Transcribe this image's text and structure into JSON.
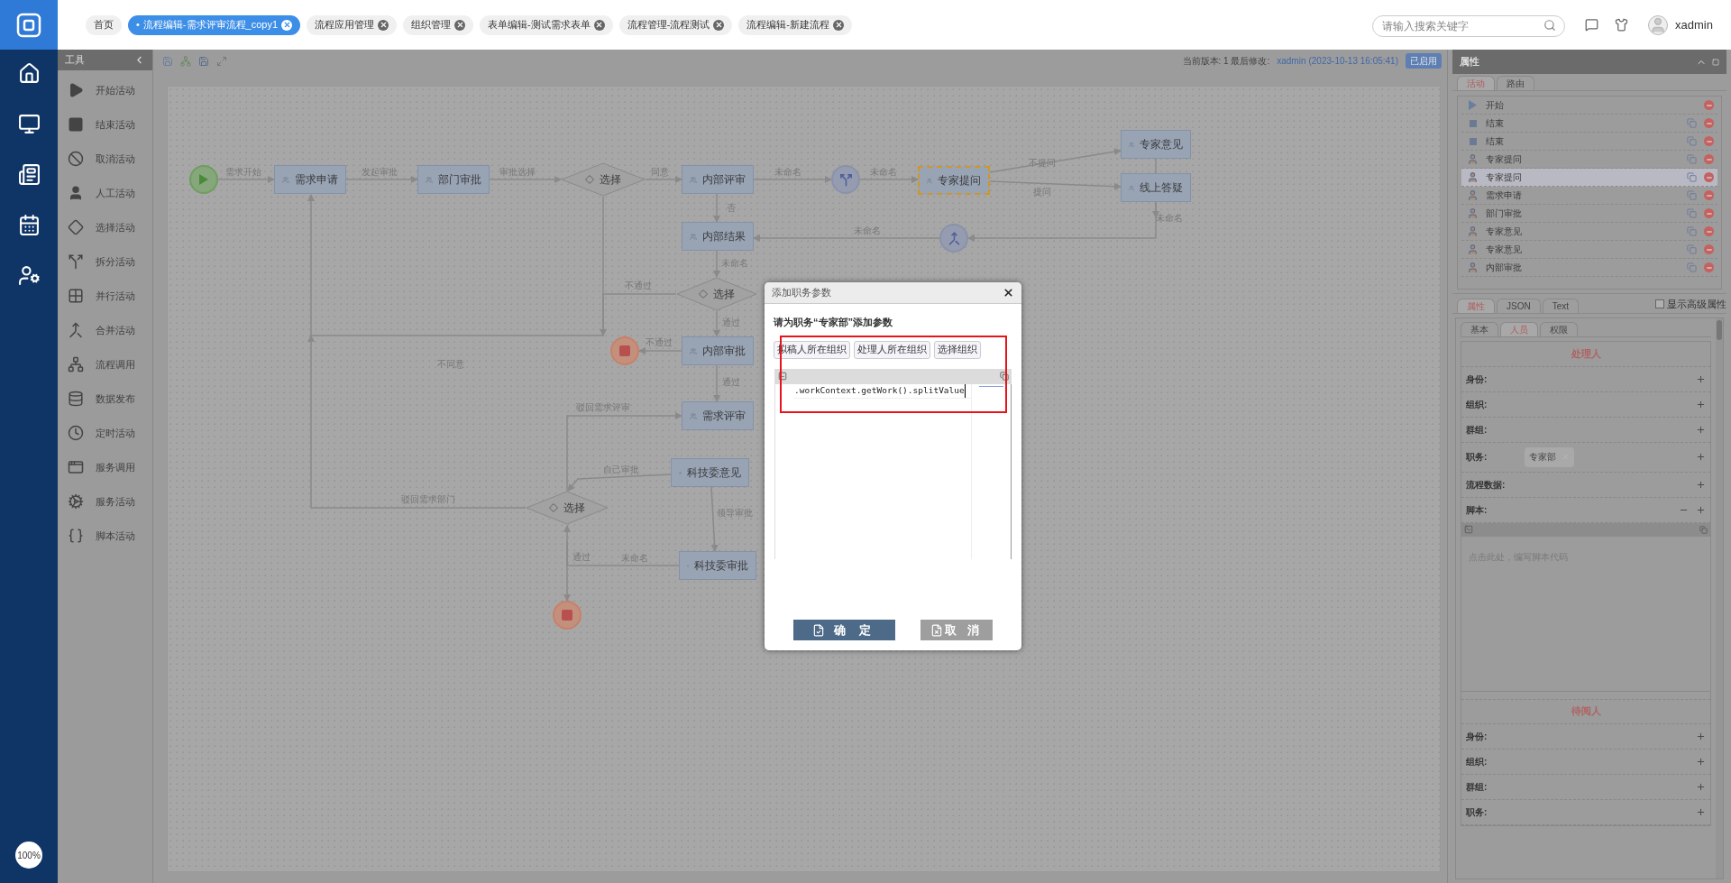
{
  "nav": {
    "zoom": "100%"
  },
  "top_tabs": [
    {
      "label": "首页",
      "selected": false,
      "closable": false
    },
    {
      "label": "流程编辑-需求评审流程_copy1",
      "marker": "•",
      "selected": true,
      "closable": true
    },
    {
      "label": "流程应用管理",
      "selected": false,
      "closable": true
    },
    {
      "label": "组织管理",
      "selected": false,
      "closable": true
    },
    {
      "label": "表单编辑-测试需求表单",
      "selected": false,
      "closable": true
    },
    {
      "label": "流程管理-流程测试",
      "selected": false,
      "closable": true
    },
    {
      "label": "流程编辑-新建流程",
      "selected": false,
      "closable": true
    }
  ],
  "search": {
    "placeholder": "请输入搜索关键字"
  },
  "user": {
    "name": "xadmin"
  },
  "toolbox": {
    "title": "工具",
    "items": [
      {
        "kind": "start",
        "label": "开始活动"
      },
      {
        "kind": "end",
        "label": "结束活动"
      },
      {
        "kind": "cancel",
        "label": "取消活动"
      },
      {
        "kind": "manual",
        "label": "人工活动"
      },
      {
        "kind": "choice",
        "label": "选择活动"
      },
      {
        "kind": "split",
        "label": "拆分活动"
      },
      {
        "kind": "parallel",
        "label": "并行活动"
      },
      {
        "kind": "merge",
        "label": "合并活动"
      },
      {
        "kind": "embed",
        "label": "流程调用"
      },
      {
        "kind": "publish",
        "label": "数据发布"
      },
      {
        "kind": "delay",
        "label": "定时活动"
      },
      {
        "kind": "invoke",
        "label": "服务调用"
      },
      {
        "kind": "service",
        "label": "服务活动"
      },
      {
        "kind": "script",
        "label": "脚本活动"
      }
    ]
  },
  "version": {
    "label": "当前版本: 1 最后修改:",
    "user": "xadmin",
    "time": "(2023-10-13 16:05:41)",
    "status": "已启用"
  },
  "diagram": {
    "nodes": [
      {
        "kind": "start",
        "selected": false
      },
      {
        "kind": "task",
        "label": "需求申请",
        "selected": false
      },
      {
        "kind": "task",
        "label": "部门审批",
        "selected": false
      },
      {
        "kind": "decision",
        "label": "选择",
        "selected": false
      },
      {
        "kind": "task",
        "label": "内部评审",
        "selected": false
      },
      {
        "kind": "split",
        "selected": false
      },
      {
        "kind": "task",
        "label": "专家提问",
        "selected": true
      },
      {
        "kind": "task",
        "label": "专家意见",
        "selected": false
      },
      {
        "kind": "task",
        "label": "线上答疑",
        "selected": false
      },
      {
        "kind": "merge",
        "selected": false
      },
      {
        "kind": "task",
        "label": "内部结果",
        "selected": false
      },
      {
        "kind": "decision",
        "label": "选择",
        "selected": false
      },
      {
        "kind": "task",
        "label": "内部审批",
        "selected": false
      },
      {
        "kind": "end",
        "selected": false
      },
      {
        "kind": "task",
        "label": "需求评审",
        "selected": false
      },
      {
        "kind": "task",
        "label": "科技委意见",
        "selected": false
      },
      {
        "kind": "decision",
        "label": "选择",
        "selected": false
      },
      {
        "kind": "task",
        "label": "科技委审批",
        "selected": false
      },
      {
        "kind": "end",
        "selected": false
      }
    ],
    "edge_labels": [
      "需求开始",
      "发起审批",
      "审批选择",
      "同意",
      "未命名",
      "未命名",
      "不提问",
      "提问",
      "未命名",
      "未命名",
      "否",
      "未命名",
      "不通过",
      "通过",
      "不通过",
      "不同意",
      "通过",
      "驳回需求评审",
      "自己审批",
      "驳回需求部门",
      "领导审批",
      "通过",
      "未命名"
    ]
  },
  "dialog": {
    "title": "添加职务参数",
    "prompt": "请为职务“专家部”添加参数",
    "org_buttons": [
      "拟稿人所在组织",
      "处理人所在组织",
      "选择组织"
    ],
    "code": ".workContext.getWork().splitValue",
    "ok": "确 定",
    "cancel": "取 消"
  },
  "properties": {
    "title": "属性",
    "list_tabs": [
      {
        "label": "活动",
        "selected": true
      },
      {
        "label": "路由",
        "selected": false
      }
    ],
    "activities": [
      {
        "kind": "start",
        "label": "开始",
        "selected": false
      },
      {
        "kind": "end",
        "label": "结束",
        "selected": false
      },
      {
        "kind": "end",
        "label": "结束",
        "selected": false
      },
      {
        "kind": "task",
        "label": "专家提问",
        "selected": false
      },
      {
        "kind": "task",
        "label": "专家提问",
        "selected": true
      },
      {
        "kind": "task",
        "label": "需求申请",
        "selected": false
      },
      {
        "kind": "task",
        "label": "部门审批",
        "selected": false
      },
      {
        "kind": "task",
        "label": "专家意见",
        "selected": false
      },
      {
        "kind": "task",
        "label": "专家意见",
        "selected": false
      },
      {
        "kind": "task",
        "label": "内部审批",
        "selected": false
      }
    ],
    "detail_tabs": [
      {
        "label": "属性",
        "selected": true
      },
      {
        "label": "JSON",
        "selected": false
      },
      {
        "label": "Text",
        "selected": false
      }
    ],
    "advanced": {
      "label": "显示高级属性",
      "checked": false
    },
    "sub_tabs": [
      {
        "label": "基本",
        "selected": false
      },
      {
        "label": "人员",
        "selected": true
      },
      {
        "label": "权限",
        "selected": false
      }
    ],
    "handler": {
      "title": "处理人",
      "fields": [
        {
          "label": "身份:"
        },
        {
          "label": "组织:"
        },
        {
          "label": "群组:"
        },
        {
          "label": "职务:",
          "chips": [
            "专家部"
          ]
        },
        {
          "label": "流程数据:"
        },
        {
          "label": "脚本:",
          "collapsible": true
        }
      ],
      "script_placeholder": "点击此处，编写脚本代码"
    },
    "reader": {
      "title": "待阅人",
      "fields": [
        {
          "label": "身份:"
        },
        {
          "label": "组织:"
        },
        {
          "label": "群组:"
        },
        {
          "label": "职务:"
        }
      ]
    }
  }
}
